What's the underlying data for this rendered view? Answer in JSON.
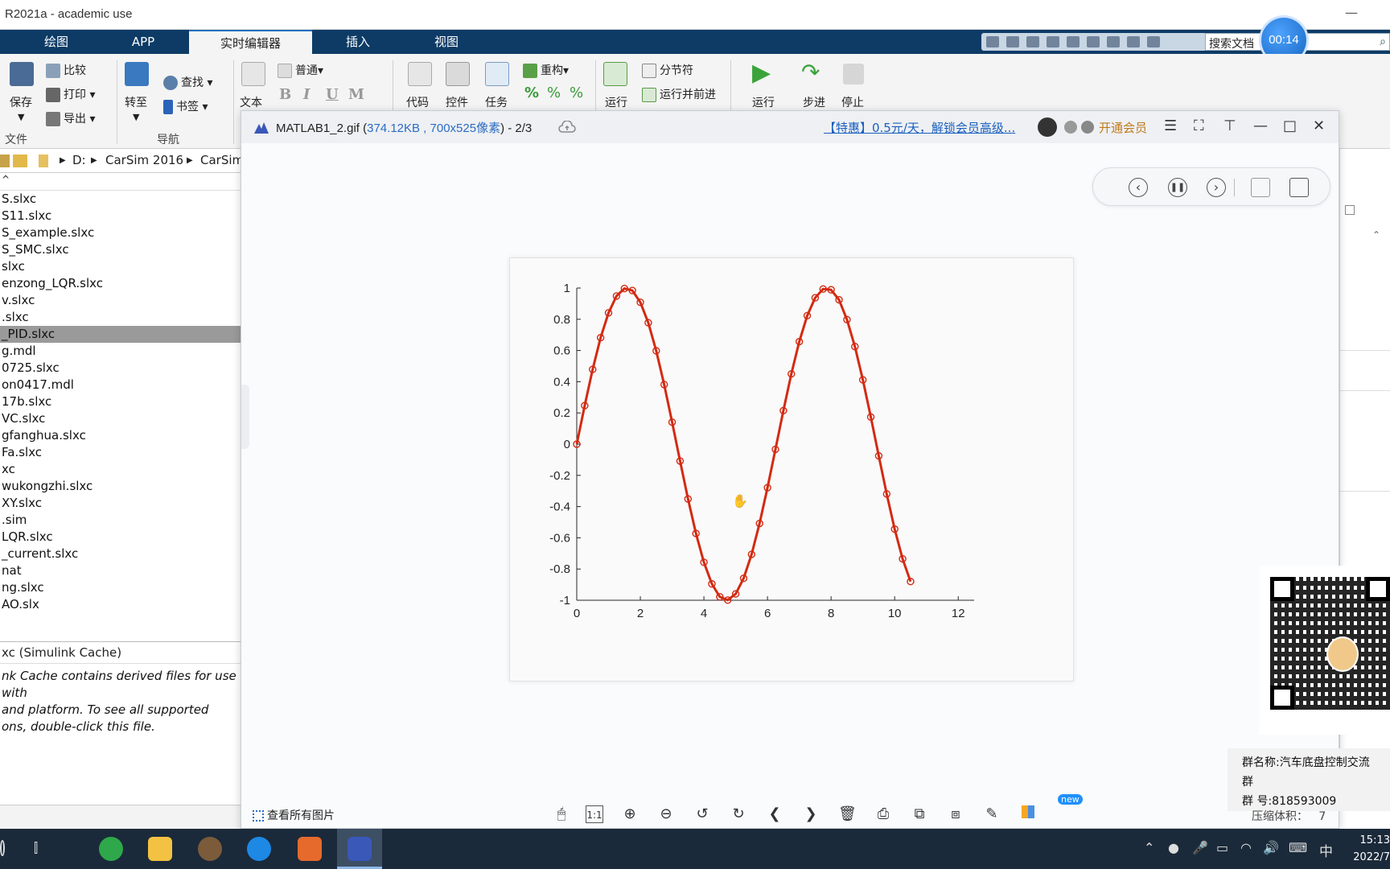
{
  "app": {
    "title": "R2021a - academic use",
    "minimize": "—"
  },
  "ribbon_tabs": [
    "绘图",
    "APP",
    "实时编辑器",
    "插入",
    "视图"
  ],
  "search": {
    "value": "搜索文档",
    "icon": "search-icon"
  },
  "timer": "00:14",
  "ribbon": {
    "file": {
      "save": "保存",
      "compare": "比较",
      "print": "打印",
      "export": "导出",
      "group": "文件"
    },
    "nav": {
      "goto": "转至",
      "find": "查找",
      "bookmark": "书签",
      "group": "导航"
    },
    "text": {
      "text": "文本",
      "style": "普通",
      "bold": "B",
      "italic": "I",
      "underline": "U",
      "mono": "M"
    },
    "code": {
      "code": "代码",
      "control": "控件",
      "task": "任务",
      "refactor": "重构"
    },
    "section": {
      "run_section": "运行",
      "section_break": "分节符",
      "run_advance": "运行并前进"
    },
    "run": {
      "run": "运行",
      "step": "步进",
      "stop": "停止"
    }
  },
  "address": {
    "drive": "D:",
    "folder1": "CarSim 2016",
    "folder2": "CarSim"
  },
  "files": [
    "S.slxc",
    "S11.slxc",
    "S_example.slxc",
    "S_SMC.slxc",
    "slxc",
    "enzong_LQR.slxc",
    "v.slxc",
    ".slxc",
    "_PID.slxc",
    "g.mdl",
    "0725.slxc",
    "on0417.mdl",
    "17b.slxc",
    "VC.slxc",
    "gfanghua.slxc",
    "Fa.slxc",
    "xc",
    "wukongzhi.slxc",
    "XY.slxc",
    ".sim",
    "LQR.slxc",
    "_current.slxc",
    "nat",
    "ng.slxc",
    "AO.slx"
  ],
  "selected_file_index": 8,
  "details": {
    "header": "xc  (Simulink Cache)",
    "lines": [
      "nk Cache contains derived files for use with",
      " and platform. To see all supported",
      "ons, double-click this file."
    ]
  },
  "viewer": {
    "filename": "MATLAB1_2.gif",
    "meta": "374.12KB , 700x525像素",
    "page": "- 2/3",
    "promo": "【特惠】0.5元/天，解锁会员高级...",
    "vip": "开通会员",
    "view_all": "查看所有图片",
    "new_badge": "new",
    "one_to_one": "1:1"
  },
  "group": {
    "name": "群名称:汽车底盘控制交流群",
    "number": "群  号:818593009"
  },
  "compress_label": "压缩体积：",
  "compress_value": "7",
  "clock": {
    "time": "15:13",
    "date": "2022/7"
  },
  "ime": "中",
  "colors": {
    "accent": "#0d3b66",
    "series": "#d32a12",
    "selected": "#9a9a9a"
  },
  "chart_data": {
    "type": "line",
    "title": "",
    "xlabel": "",
    "ylabel": "",
    "xlim": [
      0,
      12.5
    ],
    "ylim": [
      -1,
      1
    ],
    "xticks": [
      0,
      2,
      4,
      6,
      8,
      10,
      12
    ],
    "yticks": [
      -1,
      -0.8,
      -0.6,
      -0.4,
      -0.2,
      0,
      0.2,
      0.4,
      0.6,
      0.8,
      1
    ],
    "ytick_labels": [
      "-1",
      "-0.8",
      "-0.6",
      "-0.4",
      "-0.2",
      "0",
      "0.2",
      "0.4",
      "0.6",
      "0.8",
      "1"
    ],
    "marker": "circle",
    "series": [
      {
        "x": [
          0,
          0.25,
          0.5,
          0.75,
          1.0,
          1.25,
          1.5,
          1.75,
          2.0,
          2.25,
          2.5,
          2.75,
          3.0,
          3.25,
          3.5,
          3.75,
          4.0,
          4.25,
          4.5,
          4.75,
          5.0,
          5.25,
          5.5,
          5.75,
          6.0,
          6.25,
          6.5,
          6.75,
          7.0,
          7.25,
          7.5,
          7.75,
          8.0,
          8.25,
          8.5,
          8.75,
          9.0,
          9.25,
          9.5,
          9.75,
          10.0,
          10.25,
          10.5
        ],
        "y": [
          0.0,
          0.247,
          0.479,
          0.682,
          0.841,
          0.949,
          0.997,
          0.984,
          0.909,
          0.778,
          0.598,
          0.382,
          0.141,
          -0.108,
          -0.351,
          -0.572,
          -0.757,
          -0.895,
          -0.978,
          -0.999,
          -0.959,
          -0.859,
          -0.706,
          -0.508,
          -0.279,
          -0.033,
          0.215,
          0.45,
          0.657,
          0.823,
          0.938,
          0.994,
          0.989,
          0.925,
          0.798,
          0.625,
          0.412,
          0.174,
          -0.075,
          -0.319,
          -0.544,
          -0.735,
          -0.88
        ]
      }
    ]
  }
}
